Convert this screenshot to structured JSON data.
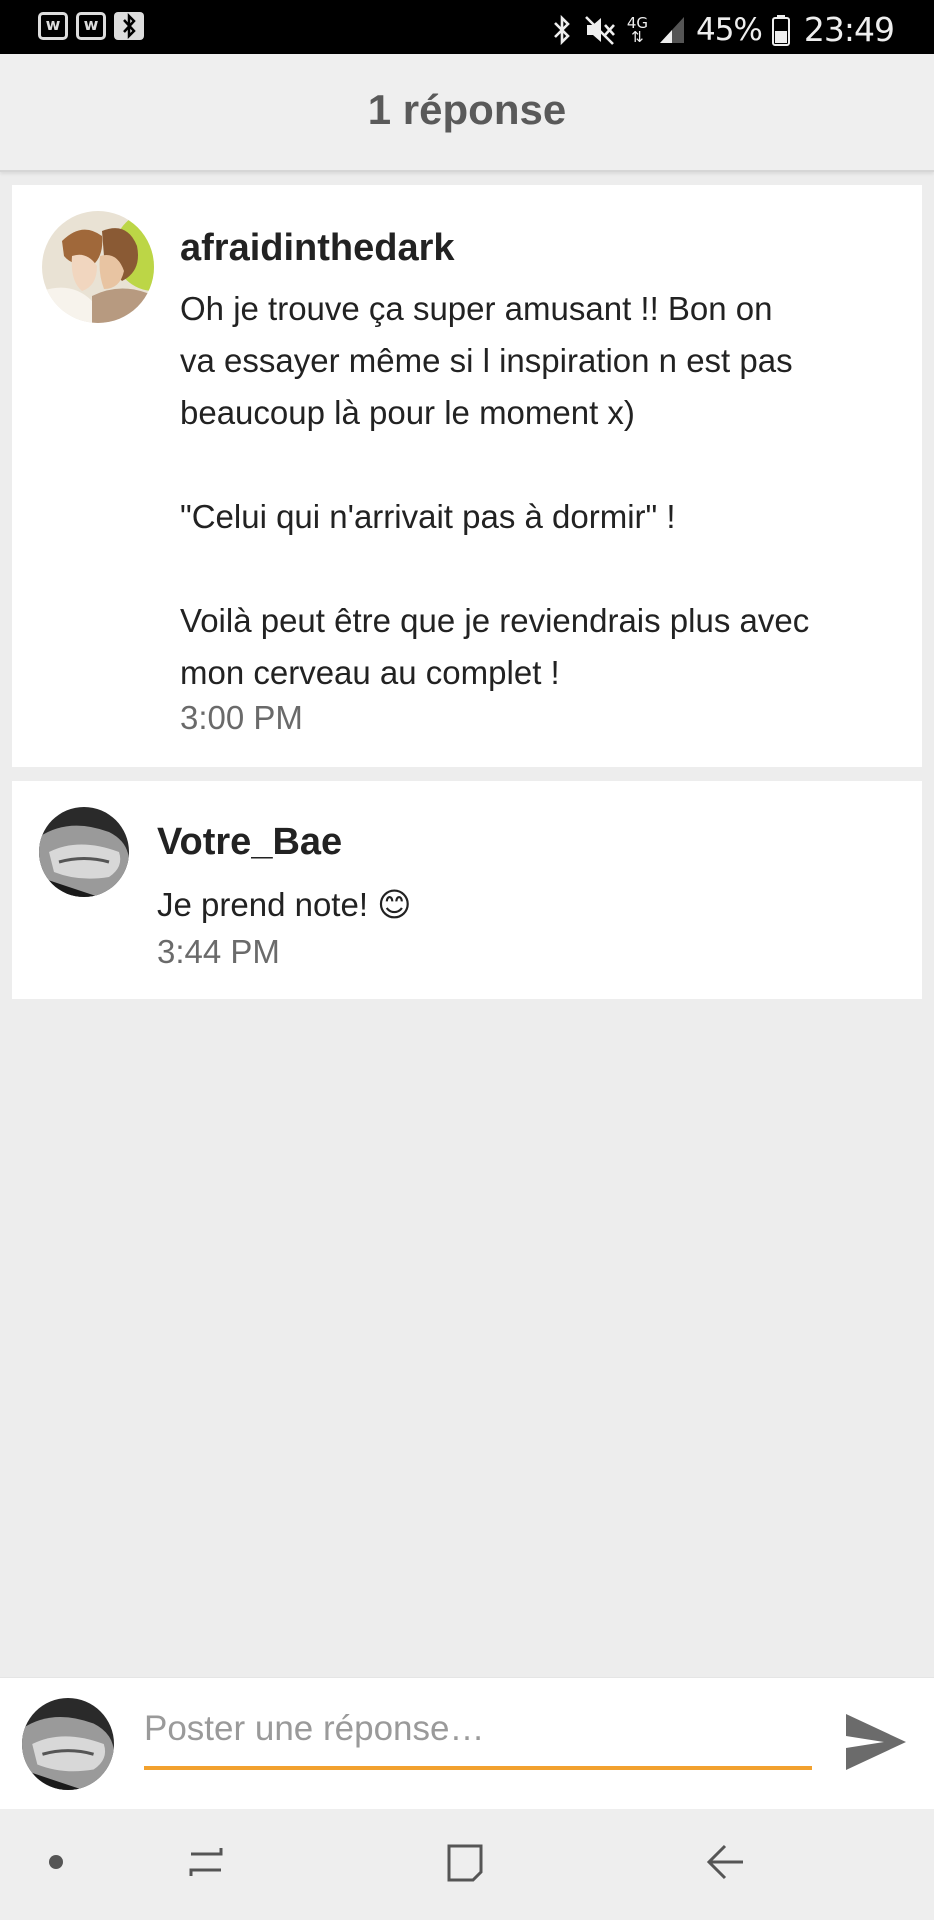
{
  "status_bar": {
    "app_icon_1": "w",
    "app_icon_2": "w",
    "app_icons": [
      "wattpad-app-icon",
      "wattpad-app-icon",
      "bluetooth-app-icon"
    ],
    "battery_percent": "45%",
    "time": "23:49",
    "network_type": "4G",
    "icons": [
      "bluetooth-icon",
      "mute-icon",
      "signal-icon",
      "battery-icon"
    ]
  },
  "header": {
    "title": "1 réponse"
  },
  "comments": [
    {
      "author": "afraidinthedark",
      "message": "Oh je trouve ça super amusant !! Bon on\nva essayer même si l inspiration n est pas\nbeaucoup là pour le moment x)\n\n\"Celui qui n'arrivait pas à dormir\" !\n\nVoilà peut être que je reviendrais plus avec\nmon cerveau au complet !",
      "time": "3:00 PM"
    },
    {
      "author": "Votre_Bae",
      "message": "Je prend note! 😊",
      "time": "3:44 PM"
    }
  ],
  "reply": {
    "placeholder": "Poster une réponse…",
    "value": ""
  },
  "nav": {
    "icons": [
      "dot-icon",
      "recent-apps-icon",
      "home-icon",
      "back-icon"
    ]
  },
  "colors": {
    "accent": "#f2a12e",
    "status_bar": "#000000",
    "background": "#ededed"
  }
}
